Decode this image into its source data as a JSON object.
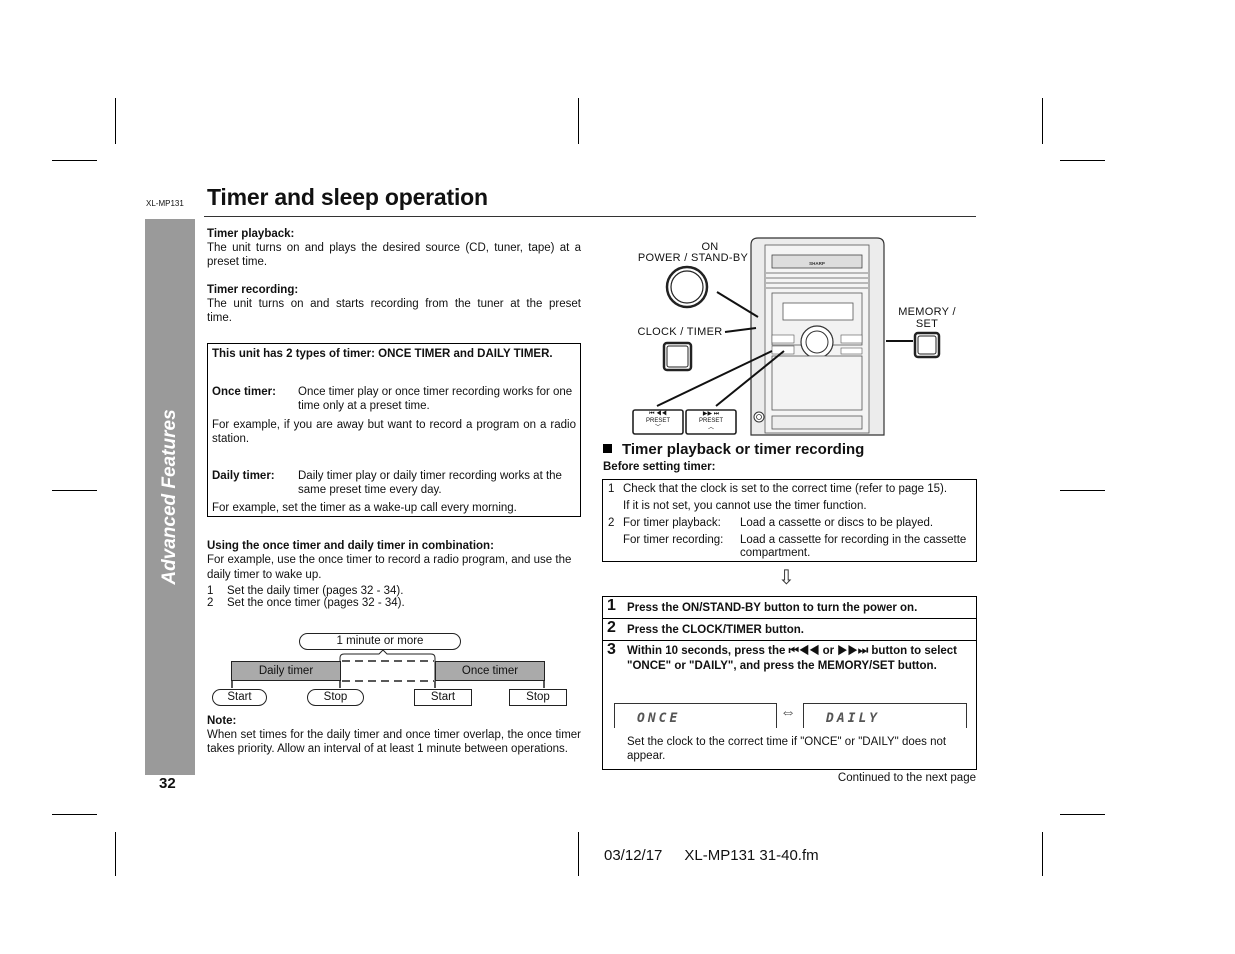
{
  "header": {
    "model_code": "XL-MP131",
    "title": "Timer and sleep operation"
  },
  "side_tab": {
    "label": "Advanced Features",
    "page_number": "32"
  },
  "left": {
    "timer_playback": {
      "heading": "Timer playback:",
      "body": "The unit turns on and plays the desired source (CD, tuner, tape) at a preset time."
    },
    "timer_recording": {
      "heading": "Timer recording:",
      "body": "The unit turns on and starts recording from the tuner at the preset time."
    },
    "types_box": {
      "heading": "This unit has 2 types of timer: ONCE TIMER and DAILY TIMER.",
      "once_label": "Once timer:",
      "once_desc": "Once timer play or once timer recording works for one time only at a preset time.",
      "once_example": "For example, if you are away but want to record a program on a radio station.",
      "daily_label": "Daily timer:",
      "daily_desc": "Daily timer play or daily timer recording works at the same preset time every day.",
      "daily_example": "For example, set the timer as a wake-up call every morning."
    },
    "combination": {
      "heading": "Using the once timer and daily timer in combination:",
      "body": "For example, use the once timer to record a radio program, and use the daily timer to wake up.",
      "steps": [
        {
          "num": "1",
          "text": "Set the daily timer (pages 32 - 34)."
        },
        {
          "num": "2",
          "text": "Set the once timer (pages 32 - 34)."
        }
      ]
    },
    "diagram": {
      "interval_label": "1 minute or more",
      "daily_bar": "Daily timer",
      "once_bar": "Once timer",
      "daily_start": "Start",
      "daily_stop": "Stop",
      "once_start": "Start",
      "once_stop": "Stop"
    },
    "note": {
      "heading": "Note:",
      "body": "When set times for the daily timer and once timer overlap, the once timer takes priority. Allow an interval of at least 1 minute between operations."
    }
  },
  "illustration": {
    "on_label": "ON",
    "power_label": "POWER / STAND-BY",
    "clock_timer_label": "CLOCK / TIMER",
    "memory_label": "MEMORY /",
    "set_label": "SET",
    "brand": "SHARP",
    "preset_down": {
      "symbols": "⏮ ◀◀",
      "label": "PRESET",
      "arrow": "﹀"
    },
    "preset_up": {
      "symbols": "▶▶ ⏭",
      "label": "PRESET",
      "arrow": "︿"
    }
  },
  "right": {
    "section_title": "Timer playback or timer recording",
    "before_heading": "Before setting timer:",
    "before_items": [
      {
        "num": "1",
        "label": "Check that the clock is set to the correct time (refer to page 15).",
        "text": ""
      },
      {
        "num": "",
        "label": "If it is not set, you cannot use the timer function.",
        "text": ""
      },
      {
        "num": "2",
        "label": "For timer playback:",
        "text": "Load a cassette or discs to be played."
      },
      {
        "num": "",
        "label": "For timer recording:",
        "text": "Load a cassette for recording in the cassette compartment."
      }
    ],
    "arrow": "⇩",
    "steps": [
      {
        "num": "1",
        "text": "Press the ON/STAND-BY button to turn the power on."
      },
      {
        "num": "2",
        "text": "Press the CLOCK/TIMER button."
      },
      {
        "num": "3",
        "text": "Within 10 seconds, press the ⏮◀◀ or ▶▶⏭ button to select \"ONCE\" or \"DAILY\", and press the MEMORY/SET button."
      }
    ],
    "lcd_once": "ONCE",
    "lcd_swap": "⇔",
    "lcd_daily": "DAILY",
    "step3_note": "Set the clock to the correct time if \"ONCE\" or \"DAILY\" does not appear.",
    "continued": "Continued to the next page"
  },
  "footer": {
    "date": "03/12/17",
    "file": "XL-MP131 31-40.fm"
  }
}
